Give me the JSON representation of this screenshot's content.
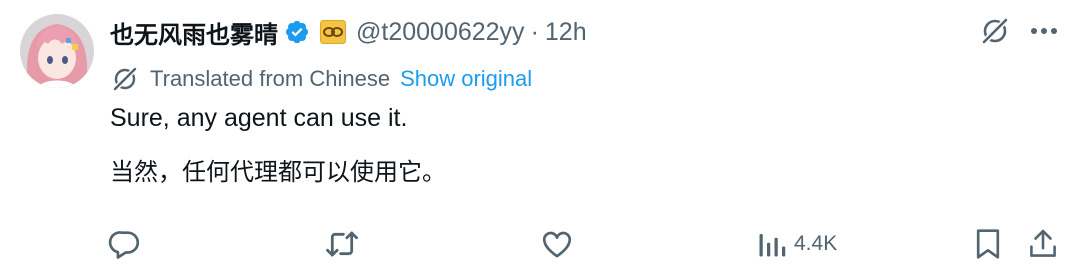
{
  "tweet": {
    "author": {
      "display_name": "也无风雨也雾晴",
      "handle": "@t20000622yy",
      "avatar_icon": "anime-avatar",
      "verified_icon": "verified-badge-icon",
      "affiliate_icon": "affiliate-badge-icon"
    },
    "separator": "·",
    "timestamp": "12h",
    "translation": {
      "label": "Translated from Chinese",
      "show_original_label": "Show original"
    },
    "translated_text": "Sure, any agent can use it.",
    "original_text": "当然，任何代理都可以使用它。",
    "actions": {
      "views_count": "4.4K"
    }
  },
  "colors": {
    "text_primary": "#0f1419",
    "text_secondary": "#536471",
    "link": "#1d9bf0",
    "verified": "#1d9bf0",
    "affiliate_bg": "#f6c445",
    "icon": "#536471"
  }
}
